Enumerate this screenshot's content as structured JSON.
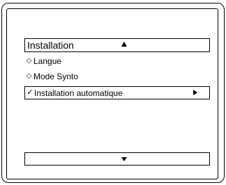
{
  "menu": {
    "title": "Installation",
    "items": [
      {
        "bullet": "◇",
        "label": "Langue"
      },
      {
        "bullet": "◇",
        "label": "Mode Synto"
      },
      {
        "bullet": "✓",
        "label": "Installation automatique",
        "selected": true
      }
    ]
  },
  "icons": {
    "header_icon": "up-arrow-icon",
    "selected_item_icon": "right-arrow-icon",
    "footer_icon": "down-arrow-icon"
  }
}
